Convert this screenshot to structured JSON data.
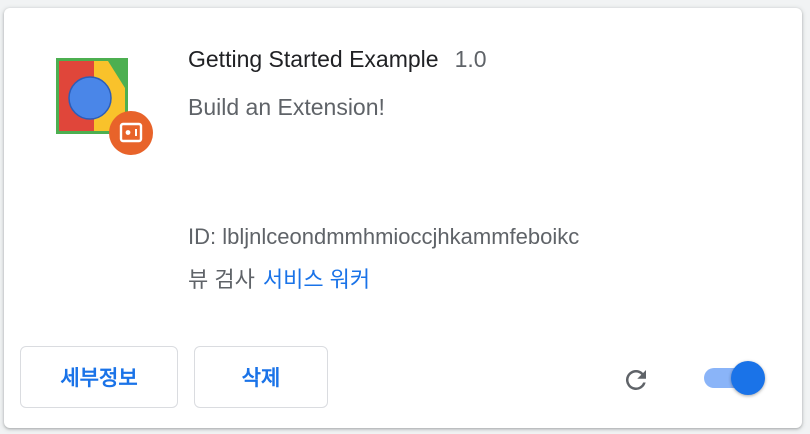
{
  "extension": {
    "name": "Getting Started Example",
    "version": "1.0",
    "description": "Build an Extension!",
    "id_text": "ID: lbljnlceondmmhmioccjhkammfeboikc",
    "inspect_views_label": "뷰 검사",
    "inspect_views_link": "서비스 워커",
    "enabled": true
  },
  "buttons": {
    "details_label": "세부정보",
    "remove_label": "삭제"
  },
  "icons": {
    "extension_icon": "getting-started-extension-icon",
    "badge_icon": "unpacked-extension-badge-icon",
    "reload_icon": "reload-icon"
  },
  "colors": {
    "accent": "#1a73e8",
    "toggle_track": "#8ab4f8",
    "badge": "#e8632a"
  }
}
